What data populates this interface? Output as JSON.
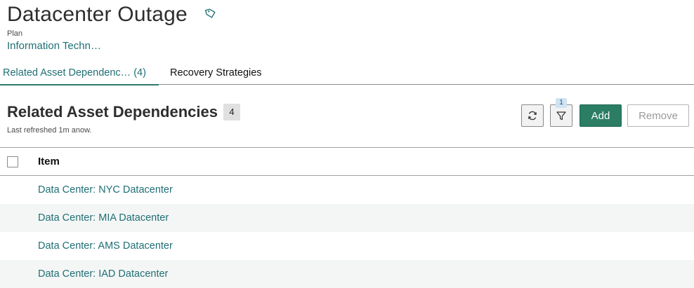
{
  "header": {
    "title": "Datacenter Outage",
    "tag_icon": "tag-icon",
    "record_type": "Plan",
    "parent_link": "Information Techn…"
  },
  "tabs": [
    {
      "label": "Related Asset Dependenc… (4)",
      "active": true
    },
    {
      "label": "Recovery Strategies",
      "active": false
    }
  ],
  "section": {
    "title": "Related Asset Dependencies",
    "count": "4",
    "refreshed": "Last refreshed 1m anow."
  },
  "toolbar": {
    "refresh_icon": "refresh-icon",
    "filter_icon": "filter-icon",
    "filter_count": "1",
    "add_label": "Add",
    "remove_label": "Remove"
  },
  "table": {
    "column_header": "Item",
    "rows": [
      "Data Center: NYC Datacenter",
      "Data Center: MIA Datacenter",
      "Data Center: AMS Datacenter",
      "Data Center: IAD Datacenter"
    ]
  },
  "colors": {
    "accent": "#1f6f75",
    "primary_button": "#2b7d64",
    "tab_underline": "#2e7a6a",
    "alt_row": "#f4f6f5",
    "badge_bg": "#e0e0e0",
    "filter_badge_bg": "#cfe3f2"
  }
}
